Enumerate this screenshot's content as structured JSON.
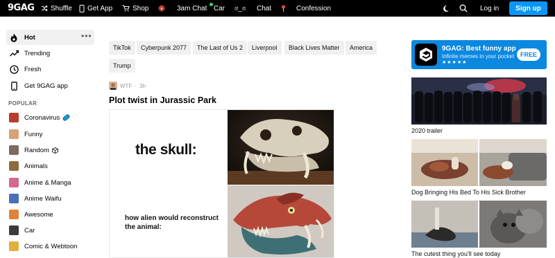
{
  "topbar": {
    "logo": "9GAG",
    "items": [
      {
        "label": "Shuffle",
        "icon": "shuffle-icon"
      },
      {
        "label": "Get App",
        "icon": "phone-icon"
      },
      {
        "label": "Shop",
        "icon": "cart-icon"
      },
      {
        "label": "",
        "icon": "badge-icon"
      },
      {
        "label": "3am Chat",
        "icon": ""
      },
      {
        "label": "Car",
        "icon": ""
      },
      {
        "label": "ಠ_ಠ",
        "icon": ""
      },
      {
        "label": "Chat",
        "icon": ""
      },
      {
        "label": "",
        "icon": "pin-icon"
      },
      {
        "label": "Confession",
        "icon": ""
      }
    ],
    "login": "Log in",
    "signup": "Sign up"
  },
  "sidebar": {
    "main": [
      {
        "label": "Hot",
        "icon": "flame-icon"
      },
      {
        "label": "Trending",
        "icon": "trending-icon"
      },
      {
        "label": "Fresh",
        "icon": "clock-icon"
      },
      {
        "label": "Get 9GAG app",
        "icon": "phone-icon"
      }
    ],
    "popular_heading": "POPULAR",
    "popular": [
      {
        "label": "Coronavirus",
        "color": "#b83c2c"
      },
      {
        "label": "Funny",
        "color": "#d9a07a"
      },
      {
        "label": "Random",
        "color": "#7c6c60"
      },
      {
        "label": "Animals",
        "color": "#8d6b3e"
      },
      {
        "label": "Anime & Manga",
        "color": "#d46a8a"
      },
      {
        "label": "Anime Waifu",
        "color": "#4a6fb8"
      },
      {
        "label": "Awesome",
        "color": "#e0823a"
      },
      {
        "label": "Car",
        "color": "#3b3b3b"
      },
      {
        "label": "Comic & Webtoon",
        "color": "#e2b03e"
      }
    ]
  },
  "tags": [
    "TikTok",
    "Cyberpunk 2077",
    "The Last of Us 2",
    "Liverpool",
    "Black Lives Matter",
    "America",
    "Trump"
  ],
  "post": {
    "section": "WTF",
    "time": "3h",
    "title": "Plot twist in Jurassic Park",
    "meme_line1": "the skull:",
    "meme_line2": "how alien would reconstruct the animal:"
  },
  "promo": {
    "title": "9GAG: Best funny app",
    "subtitle": "Infinite memes in your pocket",
    "stars": "★★★★★",
    "cta": "FREE"
  },
  "trending": [
    {
      "caption": "2020 trailer"
    },
    {
      "caption": "Dog Bringing His Bed To His Sick Brother"
    },
    {
      "caption": "The cutest thing you'll see today"
    }
  ]
}
